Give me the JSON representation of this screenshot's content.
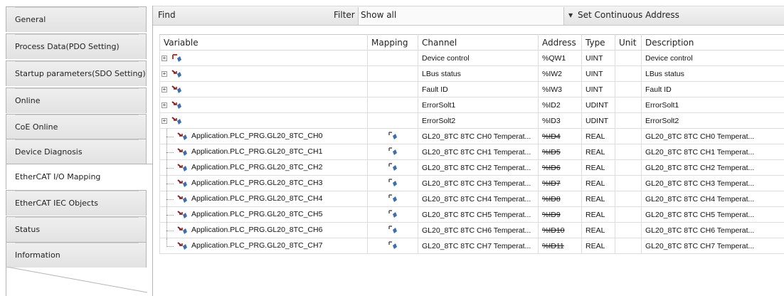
{
  "sidebar": {
    "tabs": [
      {
        "label": "General",
        "active": false
      },
      {
        "label": "Process Data(PDO Setting)",
        "active": false
      },
      {
        "label": "Startup parameters(SDO Setting)",
        "active": false
      },
      {
        "label": "Online",
        "active": false
      },
      {
        "label": "CoE Online",
        "active": false
      },
      {
        "label": "Device Diagnosis",
        "active": false
      },
      {
        "label": "EtherCAT I/O Mapping",
        "active": true
      },
      {
        "label": "EtherCAT IEC Objects",
        "active": false
      },
      {
        "label": "Status",
        "active": false
      },
      {
        "label": "Information",
        "active": false
      }
    ]
  },
  "toolbar": {
    "find_label": "Find",
    "find_value": "",
    "filter_label": "Filter",
    "filter_value": "Show all",
    "set_address_label": "Set Continuous Address"
  },
  "grid": {
    "columns": [
      "Variable",
      "Mapping",
      "Channel",
      "Address",
      "Type",
      "Unit",
      "Description"
    ],
    "rows": [
      {
        "expandable": true,
        "variable": "",
        "mapped": false,
        "channel": "Device control",
        "address": "%QW1",
        "address_struck": false,
        "type": "UINT",
        "unit": "",
        "description": "Device control",
        "icon": "output-var-icon"
      },
      {
        "expandable": true,
        "variable": "",
        "mapped": false,
        "channel": "LBus status",
        "address": "%IW2",
        "address_struck": false,
        "type": "UINT",
        "unit": "",
        "description": "LBus status",
        "icon": "input-var-icon"
      },
      {
        "expandable": true,
        "variable": "",
        "mapped": false,
        "channel": "Fault ID",
        "address": "%IW3",
        "address_struck": false,
        "type": "UINT",
        "unit": "",
        "description": "Fault ID",
        "icon": "input-var-icon"
      },
      {
        "expandable": true,
        "variable": "",
        "mapped": false,
        "channel": "ErrorSolt1",
        "address": "%ID2",
        "address_struck": false,
        "type": "UDINT",
        "unit": "",
        "description": "ErrorSolt1",
        "icon": "input-var-icon"
      },
      {
        "expandable": true,
        "variable": "",
        "mapped": false,
        "channel": "ErrorSolt2",
        "address": "%ID3",
        "address_struck": false,
        "type": "UDINT",
        "unit": "",
        "description": "ErrorSolt2",
        "icon": "input-var-icon"
      },
      {
        "expandable": false,
        "variable": "Application.PLC_PRG.GL20_8TC_CH0",
        "mapped": true,
        "channel": "GL20_8TC 8TC CH0 Temperat...",
        "address": "%ID4",
        "address_struck": true,
        "type": "REAL",
        "unit": "",
        "description": "GL20_8TC 8TC CH0 Temperat...",
        "icon": "input-var-icon"
      },
      {
        "expandable": false,
        "variable": "Application.PLC_PRG.GL20_8TC_CH1",
        "mapped": true,
        "channel": "GL20_8TC 8TC CH1 Temperat...",
        "address": "%ID5",
        "address_struck": true,
        "type": "REAL",
        "unit": "",
        "description": "GL20_8TC 8TC CH1 Temperat...",
        "icon": "input-var-icon"
      },
      {
        "expandable": false,
        "variable": "Application.PLC_PRG.GL20_8TC_CH2",
        "mapped": true,
        "channel": "GL20_8TC 8TC CH2 Temperat...",
        "address": "%ID6",
        "address_struck": true,
        "type": "REAL",
        "unit": "",
        "description": "GL20_8TC 8TC CH2 Temperat...",
        "icon": "input-var-icon"
      },
      {
        "expandable": false,
        "variable": "Application.PLC_PRG.GL20_8TC_CH3",
        "mapped": true,
        "channel": "GL20_8TC 8TC CH3 Temperat...",
        "address": "%ID7",
        "address_struck": true,
        "type": "REAL",
        "unit": "",
        "description": "GL20_8TC 8TC CH3 Temperat...",
        "icon": "input-var-icon"
      },
      {
        "expandable": false,
        "variable": "Application.PLC_PRG.GL20_8TC_CH4",
        "mapped": true,
        "channel": "GL20_8TC 8TC CH4 Temperat...",
        "address": "%ID8",
        "address_struck": true,
        "type": "REAL",
        "unit": "",
        "description": "GL20_8TC 8TC CH4 Temperat...",
        "icon": "input-var-icon"
      },
      {
        "expandable": false,
        "variable": "Application.PLC_PRG.GL20_8TC_CH5",
        "mapped": true,
        "channel": "GL20_8TC 8TC CH5 Temperat...",
        "address": "%ID9",
        "address_struck": true,
        "type": "REAL",
        "unit": "",
        "description": "GL20_8TC 8TC CH5 Temperat...",
        "icon": "input-var-icon"
      },
      {
        "expandable": false,
        "variable": "Application.PLC_PRG.GL20_8TC_CH6",
        "mapped": true,
        "channel": "GL20_8TC 8TC CH6 Temperat...",
        "address": "%ID10",
        "address_struck": true,
        "type": "REAL",
        "unit": "",
        "description": "GL20_8TC 8TC CH6 Temperat...",
        "icon": "input-var-icon"
      },
      {
        "expandable": false,
        "variable": "Application.PLC_PRG.GL20_8TC_CH7",
        "mapped": true,
        "channel": "GL20_8TC 8TC CH7 Temperat...",
        "address": "%ID11",
        "address_struck": true,
        "type": "REAL",
        "unit": "",
        "description": "GL20_8TC 8TC CH7 Temperat...",
        "icon": "input-var-icon"
      }
    ]
  },
  "colors": {
    "input_arrow": "#8b1a1a",
    "var_diamond": "#3a6fb5",
    "output_arrow": "#c0392b"
  }
}
